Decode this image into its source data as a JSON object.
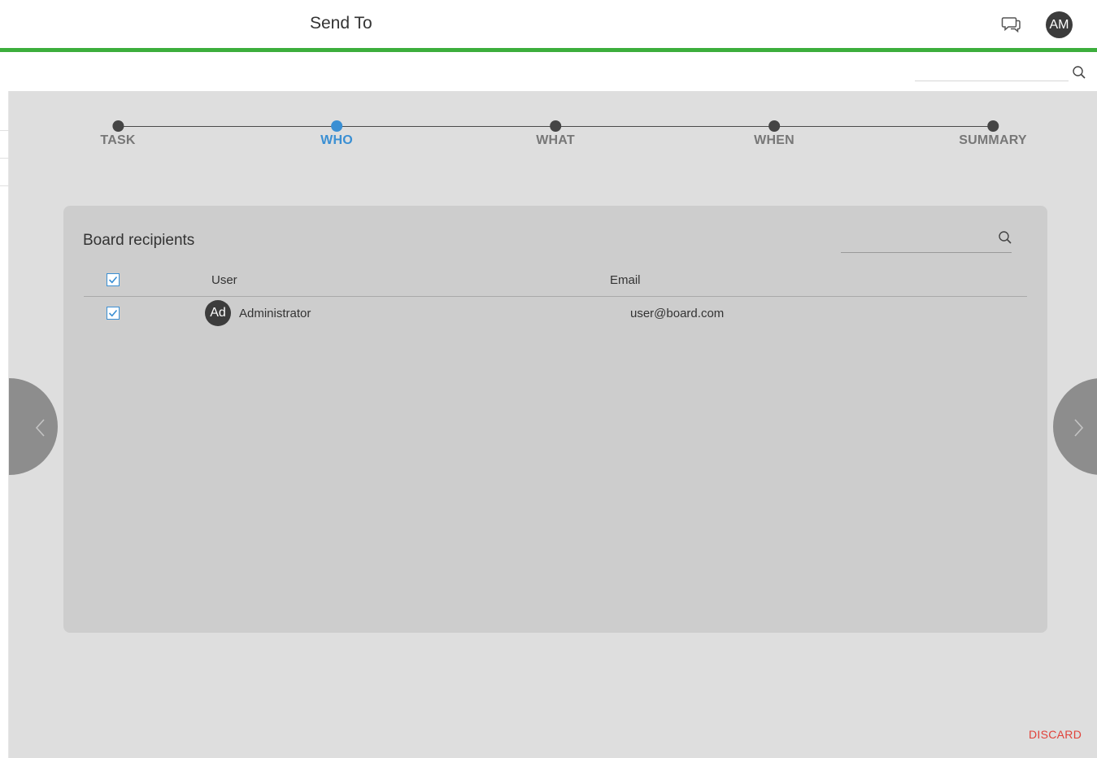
{
  "header": {
    "title": "Send To",
    "avatar_initials": "AM",
    "chat_icon": "chat-bubbles-icon",
    "accent_color": "#3cae3c"
  },
  "search": {
    "placeholder": "",
    "icon": "search-icon"
  },
  "stepper": {
    "steps": [
      {
        "label": "TASK",
        "active": false
      },
      {
        "label": "WHO",
        "active": true
      },
      {
        "label": "WHAT",
        "active": false
      },
      {
        "label": "WHEN",
        "active": false
      },
      {
        "label": "SUMMARY",
        "active": false
      }
    ],
    "active_color": "#3a8fd3"
  },
  "recipients": {
    "title": "Board recipients",
    "search_placeholder": "",
    "columns": [
      "User",
      "Email"
    ],
    "select_all_checked": true,
    "rows": [
      {
        "checked": true,
        "initials": "Ad",
        "user": "Administrator",
        "email": "user@board.com"
      }
    ]
  },
  "navigation": {
    "prev_icon": "chevron-left-icon",
    "next_icon": "chevron-right-icon"
  },
  "footer": {
    "discard_label": "DISCARD",
    "discard_color": "#e0423a"
  }
}
